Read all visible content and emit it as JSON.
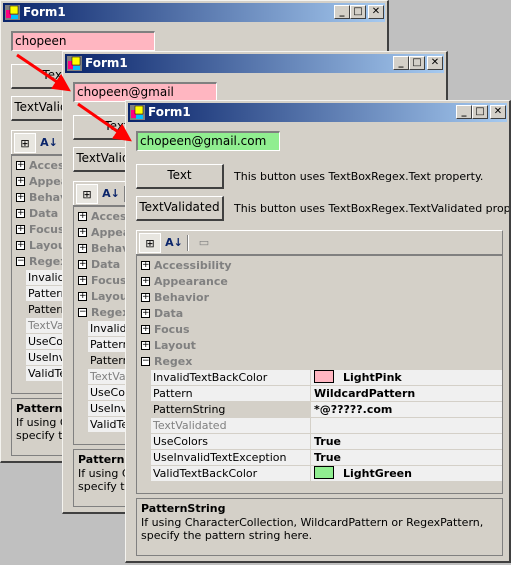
{
  "form": {
    "title": "Form1",
    "buttons": [
      {
        "label": "Text",
        "description": "This button uses TextBoxRegex.Text property."
      },
      {
        "label": "TextValidated",
        "description": "This button uses TextBoxRegex.TextValidated property."
      }
    ],
    "toolbar": [
      {
        "name": "categorized-icon",
        "glyph": "⊞"
      },
      {
        "name": "alphabetical-icon",
        "glyph": "A↓"
      },
      {
        "name": "property-pages-icon",
        "glyph": "▭"
      }
    ],
    "categories": [
      {
        "name": "Accessibility",
        "expanded": false
      },
      {
        "name": "Appearance",
        "expanded": false
      },
      {
        "name": "Behavior",
        "expanded": false
      },
      {
        "name": "Data",
        "expanded": false
      },
      {
        "name": "Focus",
        "expanded": false
      },
      {
        "name": "Layout",
        "expanded": false
      },
      {
        "name": "Regex",
        "expanded": true
      }
    ],
    "properties": [
      {
        "name": "InvalidTextBackColor",
        "value": "LightPink",
        "swatch": "#ffb6c1"
      },
      {
        "name": "Pattern",
        "value": "WildcardPattern"
      },
      {
        "name": "PatternString",
        "value": "*@?????.com",
        "selected": true
      },
      {
        "name": "TextValidated",
        "value": "",
        "disabled": true
      },
      {
        "name": "UseColors",
        "value": "True"
      },
      {
        "name": "UseInvalidTextException",
        "value": "True"
      },
      {
        "name": "ValidTextBackColor",
        "value": "LightGreen",
        "swatch": "#90ee90"
      }
    ],
    "description": {
      "title": "PatternString",
      "text": "If using CharacterCollection, WildcardPattern or RegexPattern, specify the pattern string here."
    }
  },
  "windows": [
    {
      "textbox_value": "chopeen",
      "textbox_color": "#ffb6c1",
      "state": "invalid"
    },
    {
      "textbox_value": "chopeen@gmail",
      "textbox_color": "#ffb6c1",
      "state": "invalid"
    },
    {
      "textbox_value": "chopeen@gmail.com",
      "textbox_color": "#90ee90",
      "state": "valid"
    }
  ],
  "colors": {
    "arrow": "#ff0000",
    "title_start": "#0a246a",
    "title_end": "#a6caf0"
  }
}
